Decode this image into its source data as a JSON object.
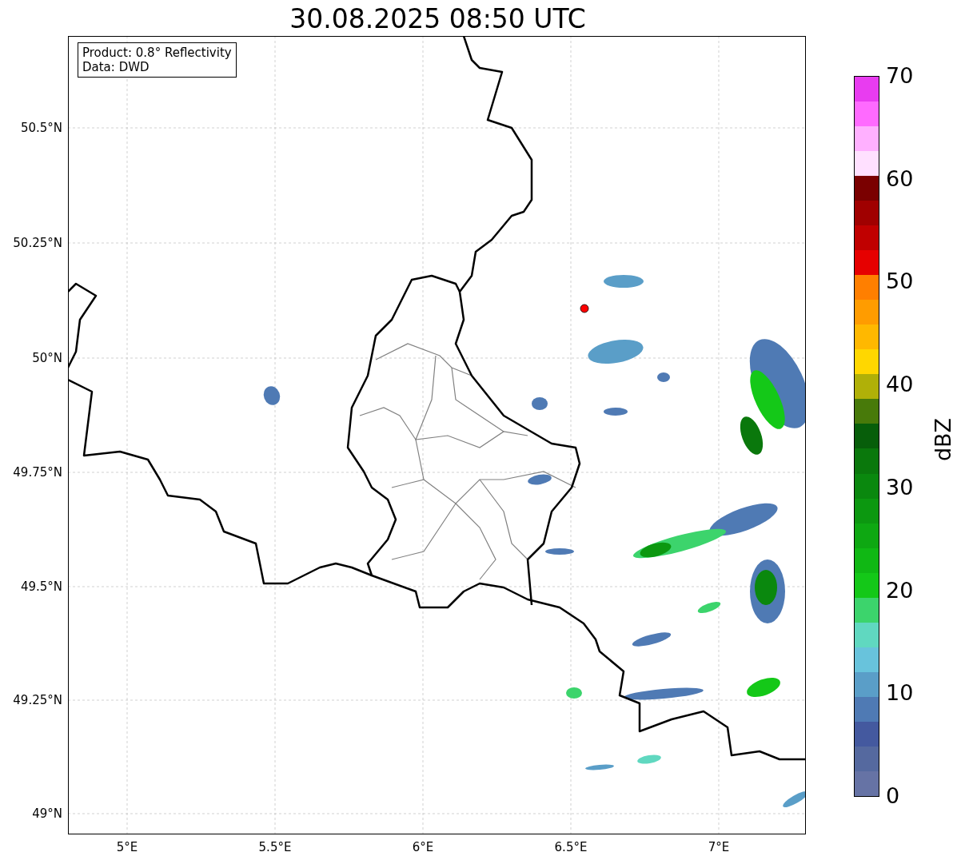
{
  "title": "30.08.2025 08:50 UTC",
  "legend": {
    "lines": [
      "Product: 0.8° Reflectivity",
      "Data: DWD"
    ]
  },
  "map": {
    "x_ticks": [
      "5°E",
      "5.5°E",
      "6°E",
      "6.5°E",
      "7°E"
    ],
    "y_ticks": [
      "50.5°N",
      "50.25°N",
      "50°N",
      "49.75°N",
      "49.5°N",
      "49.25°N",
      "49°N"
    ]
  },
  "colorbar": {
    "label": "dBZ",
    "ticks": [
      "70",
      "60",
      "50",
      "40",
      "30",
      "20",
      "10",
      "0"
    ],
    "segments": [
      {
        "color": "#e83cf0"
      },
      {
        "color": "#ff6aff"
      },
      {
        "color": "#ffb0ff"
      },
      {
        "color": "#ffe0ff"
      },
      {
        "color": "#7a0000"
      },
      {
        "color": "#a00000"
      },
      {
        "color": "#c00000"
      },
      {
        "color": "#e60000"
      },
      {
        "color": "#ff7f00"
      },
      {
        "color": "#ff9c00"
      },
      {
        "color": "#ffb800"
      },
      {
        "color": "#ffd700"
      },
      {
        "color": "#b0b008"
      },
      {
        "color": "#487a0a"
      },
      {
        "color": "#075e0a"
      },
      {
        "color": "#0a780c"
      },
      {
        "color": "#0a880e"
      },
      {
        "color": "#0c9810"
      },
      {
        "color": "#0ea812"
      },
      {
        "color": "#10b814"
      },
      {
        "color": "#14c818"
      },
      {
        "color": "#3cd46c"
      },
      {
        "color": "#60d8c0"
      },
      {
        "color": "#68c3dc"
      },
      {
        "color": "#5a9ec8"
      },
      {
        "color": "#4f7ab4"
      },
      {
        "color": "#44599f"
      },
      {
        "color": "#55699f"
      },
      {
        "color": "#6673a5"
      }
    ]
  }
}
